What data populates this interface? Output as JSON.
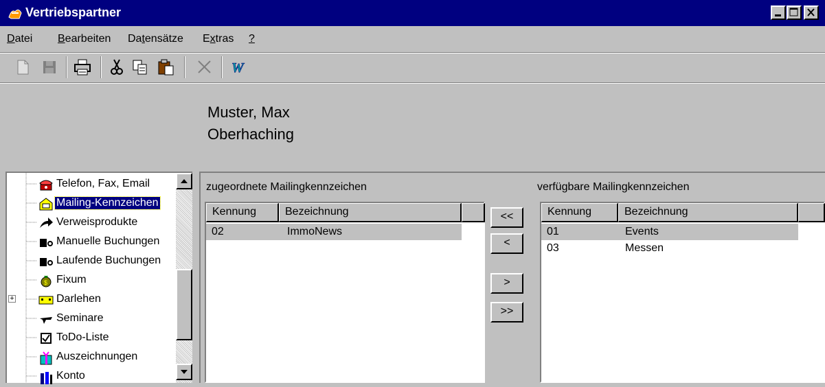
{
  "window": {
    "title": "Vertriebspartner"
  },
  "menu": [
    {
      "pre": "",
      "accel": "D",
      "post": "atei"
    },
    {
      "pre": "",
      "accel": "B",
      "post": "earbeiten"
    },
    {
      "pre": "Da",
      "accel": "t",
      "post": "ensätze"
    },
    {
      "pre": "E",
      "accel": "x",
      "post": "tras"
    },
    {
      "pre": "",
      "accel": "?",
      "post": ""
    }
  ],
  "header": {
    "name": "Muster, Max",
    "city": "Oberhaching"
  },
  "tree": {
    "items": [
      {
        "label": "Telefon, Fax, Email",
        "icon": "telephone-icon"
      },
      {
        "label": "Mailing-Kennzeichen",
        "icon": "mailbox-icon"
      },
      {
        "label": "Verweisprodukte",
        "icon": "redirect-arrow-icon"
      },
      {
        "label": "Manuelle Buchungen",
        "icon": "booking-icon"
      },
      {
        "label": "Laufende Buchungen",
        "icon": "booking-icon"
      },
      {
        "label": "Fixum",
        "icon": "money-bag-icon"
      },
      {
        "label": "Darlehen",
        "icon": "loan-icon"
      },
      {
        "label": "Seminare",
        "icon": "seminar-icon"
      },
      {
        "label": "ToDo-Liste",
        "icon": "checkbox-icon"
      },
      {
        "label": "Auszeichnungen",
        "icon": "gift-icon"
      },
      {
        "label": "Konto",
        "icon": "account-icon"
      }
    ],
    "selected_index": 1,
    "expand_symbol": "+"
  },
  "assigned": {
    "title": "zugeordnete Mailingkennzeichen",
    "col_id": "Kennung",
    "col_name": "Bezeichnung",
    "rows": [
      {
        "id": "02",
        "name": "ImmoNews"
      }
    ]
  },
  "available": {
    "title": "verfügbare Mailingkennzeichen",
    "col_id": "Kennung",
    "col_name": "Bezeichnung",
    "rows": [
      {
        "id": "01",
        "name": "Events"
      },
      {
        "id": "03",
        "name": "Messen"
      }
    ]
  },
  "buttons": {
    "all_left": "<<",
    "one_left": "<",
    "one_right": ">",
    "all_right": ">>"
  },
  "colors": {
    "titlebar": "#000080",
    "face": "#c0c0c0",
    "selection": "#000080"
  }
}
